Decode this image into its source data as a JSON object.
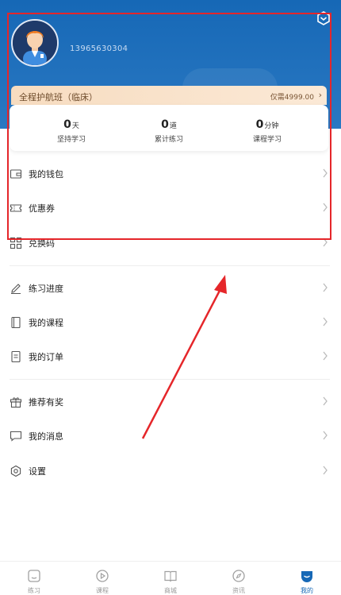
{
  "profile": {
    "phone": "13965630304"
  },
  "vip": {
    "title": "全程护航班（临床）",
    "price": "仅需4999.00"
  },
  "stats": [
    {
      "num": "0",
      "unit": "天",
      "label": "坚持学习"
    },
    {
      "num": "0",
      "unit": "道",
      "label": "累计练习"
    },
    {
      "num": "0",
      "unit": "分钟",
      "label": "课程学习"
    }
  ],
  "menu": [
    {
      "label": "我的钱包",
      "icon": "wallet-icon"
    },
    {
      "label": "优惠券",
      "icon": "coupon-icon"
    },
    {
      "label": "兑换码",
      "icon": "grid-icon"
    },
    {
      "label": "练习进度",
      "icon": "pencil-icon"
    },
    {
      "label": "我的课程",
      "icon": "book-icon"
    },
    {
      "label": "我的订单",
      "icon": "order-icon"
    },
    {
      "label": "推荐有奖",
      "icon": "gift-icon"
    },
    {
      "label": "我的消息",
      "icon": "message-icon"
    },
    {
      "label": "设置",
      "icon": "gear-icon"
    }
  ],
  "tabs": [
    {
      "label": "练习",
      "icon": "practice-icon"
    },
    {
      "label": "课程",
      "icon": "play-icon"
    },
    {
      "label": "商城",
      "icon": "shop-icon"
    },
    {
      "label": "资讯",
      "icon": "compass-icon"
    },
    {
      "label": "我的",
      "icon": "profile-icon",
      "active": true
    }
  ],
  "colors": {
    "header": "#1668b6",
    "accent": "#1668b6",
    "annotation": "#e5262a"
  }
}
